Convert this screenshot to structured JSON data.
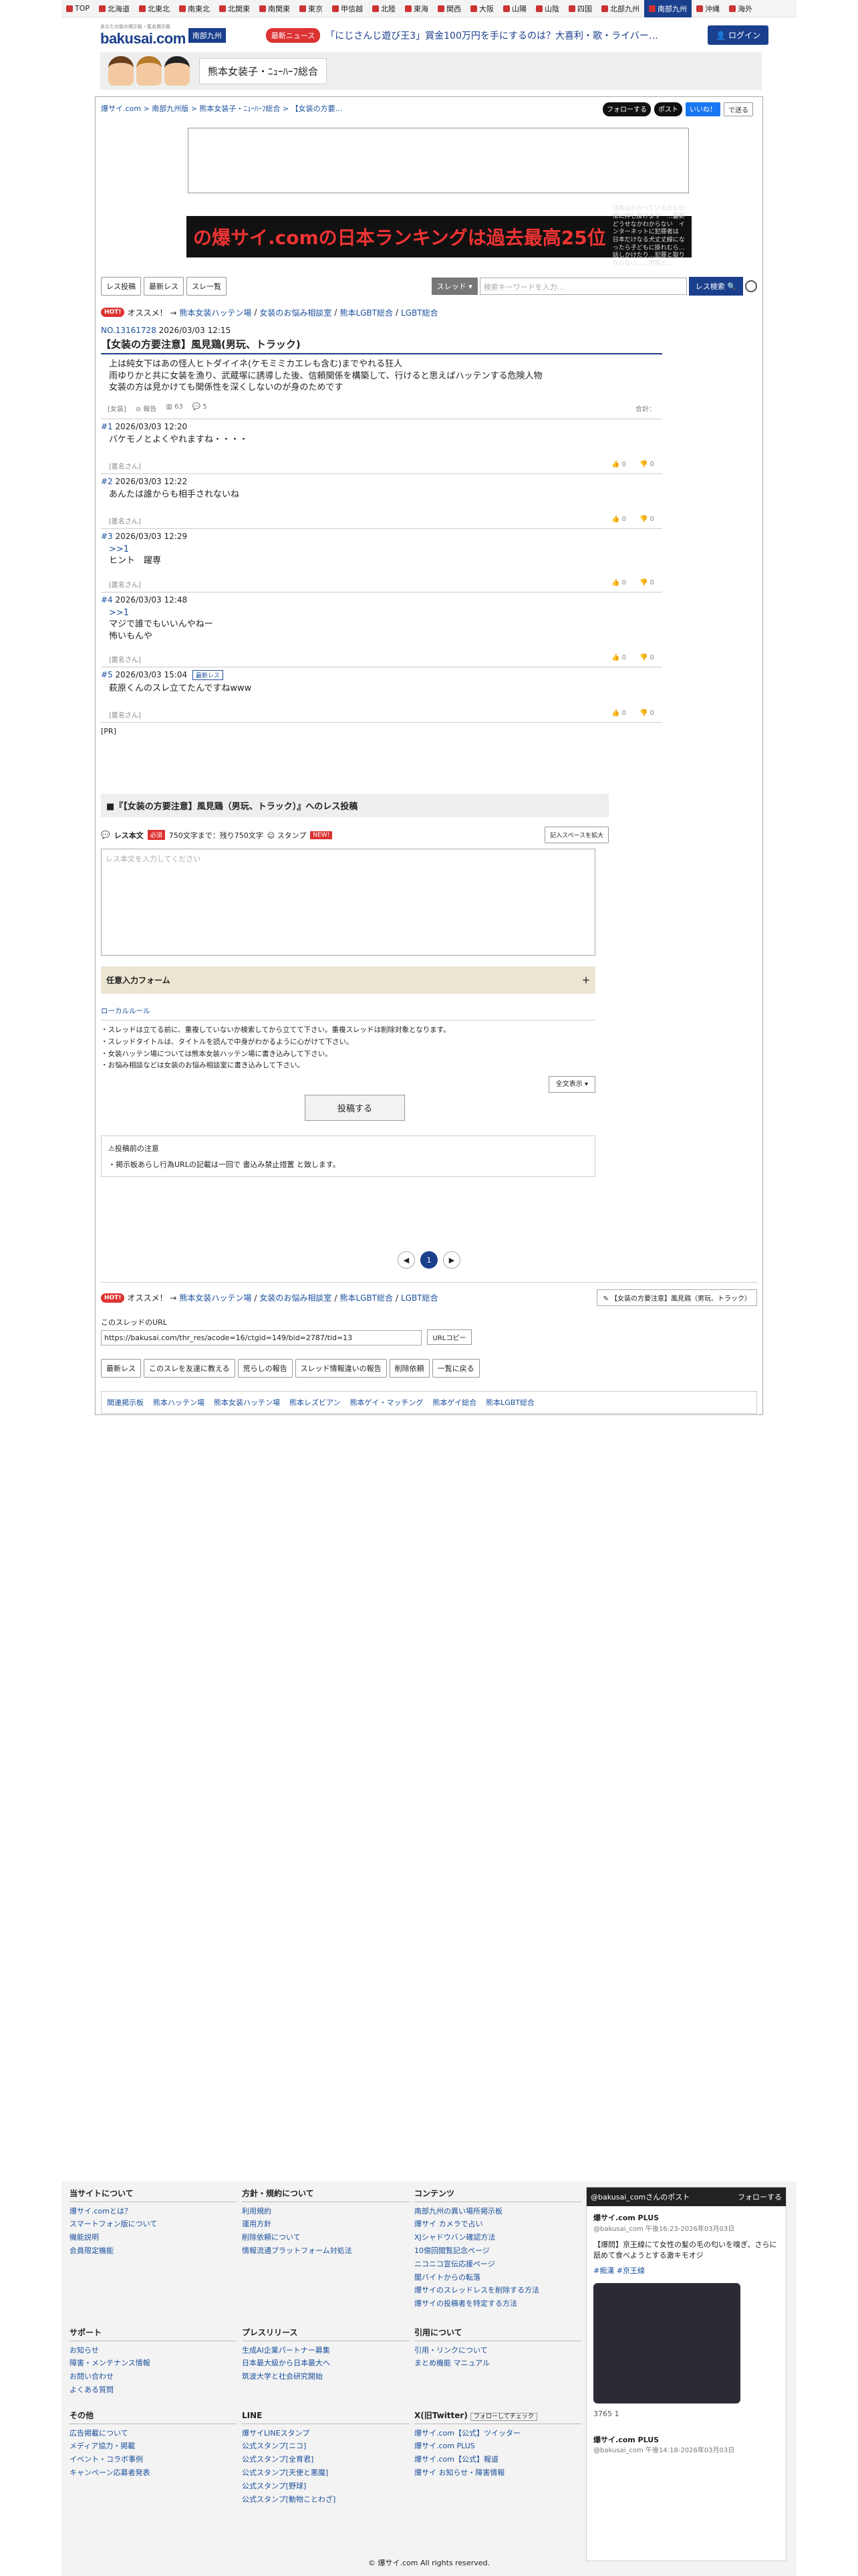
{
  "nav": {
    "regions": [
      "TOP",
      "北海道",
      "北東北",
      "南東北",
      "北関東",
      "南関東",
      "東京",
      "甲信越",
      "北陸",
      "東海",
      "関西",
      "大阪",
      "山陽",
      "山陰",
      "四国",
      "北部九州",
      "南部九州",
      "沖縄",
      "海外"
    ],
    "active": "南部九州"
  },
  "header": {
    "logo": "bakusai.com",
    "logo_sub": "あなたの街の掲示板・匿名掲示板",
    "region": "南部九州",
    "news_badge": "最新ニュース",
    "news_text": "「にじさんじ遊び王3」賞金100万円を手にするのは？大喜利・歌・ライバー…",
    "login": "ログイン"
  },
  "board": {
    "name": "熊本女装子・ﾆｭｰﾊｰﾌ総合"
  },
  "breadcrumb": "爆サイ.com > 南部九州版 > 熊本女装子・ﾆｭｰﾊｰﾌ総合 > 【女装の方要…",
  "share": {
    "follow": "フォローする",
    "post": "ポスト",
    "like": "いいね！",
    "mail": "で送る"
  },
  "rank_banner": {
    "big": "の爆サイ.comの日本ランキングは過去最高25位",
    "small": "住所はわかっているから日常に押し掛けます　…最新　どうせなかわからない　インターネットに犯罪者は　日本だけなる犬丈丈線になったら子どもに掛れむら…　話しかけたり…犯罪と取りならない……学校と…"
  },
  "toolbar": {
    "b1": "レス投稿",
    "b2": "最新レス",
    "b3": "スレ一覧",
    "select": "スレッド ▾",
    "placeholder": "検索キーワードを入力...",
    "search": "レス検索"
  },
  "rec": {
    "hot": "HOT!",
    "label": "オススメ！ →",
    "links": [
      "熊本女装ハッテン場",
      "女装のお悩み相談室",
      "熊本LGBT総合",
      "LGBT総合"
    ]
  },
  "thread": {
    "no": "NO.13161728",
    "date": "2026/03/03 12:15",
    "title": "【女装の方要注意】風見鶏(男玩、トラック)",
    "body": [
      "上は純女下はあの怪人ヒトダイイネ(ケモミミカエレも含む)までやれる狂人",
      "雨ゆりかと共に女装を漁り、武蔵塚に誘導した後、信頼関係を構築して、行けると思えばハッテンする危険人物",
      "女装の方は見かけても関係性を深くしないのが身のためです"
    ],
    "category": "[女装]",
    "report": "報告",
    "views": "63",
    "replies": "5",
    "total": "合計："
  },
  "posts": [
    {
      "num": "#1",
      "date": "2026/03/03 12:20",
      "body": [
        "バケモノとよくやれますね・・・・"
      ],
      "author": "[匿名さん]",
      "up": "0",
      "down": "0",
      "new": ""
    },
    {
      "num": "#2",
      "date": "2026/03/03 12:22",
      "body": [
        "あんたは誰からも相手されないね"
      ],
      "author": "[匿名さん]",
      "up": "0",
      "down": "0",
      "new": ""
    },
    {
      "num": "#3",
      "date": "2026/03/03 12:29",
      "body": [
        ">>1",
        "ヒント　躍専"
      ],
      "author": "[匿名さん]",
      "up": "0",
      "down": "0",
      "new": ""
    },
    {
      "num": "#4",
      "date": "2026/03/03 12:48",
      "body": [
        ">>1",
        "マジで誰でもいいんやねー",
        "怖いもんや"
      ],
      "author": "[匿名さん]",
      "up": "0",
      "down": "0",
      "new": ""
    },
    {
      "num": "#5",
      "date": "2026/03/03 15:04",
      "body": [
        "萩原くんのスレ立てたんですねwww"
      ],
      "author": "[匿名さん]",
      "up": "0",
      "down": "0",
      "new": "最新レス"
    }
  ],
  "pr": "[PR]",
  "form": {
    "head": "■『【女装の方要注意】風見鶏（男玩、トラック）』へのレス投稿",
    "label": "レス本文",
    "required": "必須",
    "limit": "750文字まで：残り750文字",
    "stamp": "スタンプ",
    "new": "NEW!",
    "expand": "記入スペースを拡大",
    "placeholder": "レス本文を入力してください",
    "optional": "任意入力フォーム",
    "plus": "＋",
    "rules_title": "ローカルルール",
    "rules": [
      "・スレッドは立てる前に、重複していないか検索してから立てて下さい。重複スレッドは削除対象となります。",
      "・スレッドタイトルは、タイトルを読んで中身がわかるように心がけて下さい。",
      "・女装ハッテン場については熊本女装ハッテン場に書き込みして下さい。",
      "・お悩み相談などは女装のお悩み相談室に書き込みして下さい。"
    ],
    "show_all": "全文表示 ▾",
    "submit": "投稿する",
    "notice_title": "⚠投稿前の注意",
    "notice": "・掲示板あらし行為URLの記載は一回で 書込み禁止措置 と致します。"
  },
  "pager": {
    "prev": "◀",
    "page": "1",
    "next": "▶"
  },
  "bottom": {
    "tweet": "【女装の方要注意】風見鶏（男玩、トラック）",
    "url_label": "このスレッドのURL",
    "url": "https://bakusai.com/thr_res/acode=16/ctgid=149/bid=2787/tid=13",
    "copy": "URLコピー",
    "actions": [
      "最新レス",
      "このスレを友達に教える",
      "荒らしの報告",
      "スレッド情報違いの報告",
      "削除依頼",
      "一覧に戻る"
    ],
    "related": "関連掲示板",
    "related_links": [
      "熊本ハッテン場",
      "熊本女装ハッテン場",
      "熊本レズビアン",
      "熊本ゲイ・マッチング",
      "熊本ゲイ総合",
      "熊本LGBT総合"
    ]
  },
  "footer": {
    "about": {
      "title": "当サイトについて",
      "items": [
        "爆サイ.comとは？",
        "スマートフォン版について",
        "機能説明",
        "会員限定機能"
      ]
    },
    "terms": {
      "title": "方針・規約について",
      "items": [
        "利用規約",
        "運用方針",
        "削除依頼について",
        "情報流通プラットフォーム対処法"
      ]
    },
    "contents": {
      "title": "コンテンツ",
      "items": [
        "南部九州の異い場所掲示板",
        "爆サイ カメラで占い",
        "XJシャドウバン確認方法",
        "10億回閲覧記念ページ",
        "ニコニコ宣伝応援ページ",
        "闇バイトからの転落",
        "爆サイのスレッドレスを削除する方法",
        "爆サイの投稿者を特定する方法"
      ]
    },
    "support": {
      "title": "サポート",
      "items": [
        "お知らせ",
        "障害・メンテナンス情報",
        "お問い合わせ",
        "よくある質問"
      ]
    },
    "press": {
      "title": "プレスリリース",
      "items": [
        "生成AI企業パートナー募集",
        "日本最大級から日本最大へ",
        "筑波大学と社会研究開始"
      ]
    },
    "quote": {
      "title": "引用について",
      "items": [
        "引用・リンクについて",
        "まとめ機能 マニュアル"
      ]
    },
    "other": {
      "title": "その他",
      "items": [
        "広告掲載について",
        "メディア協力・掲載",
        "イベント・コラボ事例",
        "キャンペーン応募者発表"
      ]
    },
    "line": {
      "title": "LINE",
      "items": [
        "爆サイLINEスタンプ",
        "公式スタンプ[ニコ]",
        "公式スタンプ[全育君]",
        "公式スタンプ[天使と悪魔]",
        "公式スタンプ[野球]",
        "公式スタンプ[動物ことわざ]"
      ]
    },
    "x": {
      "title": "X(旧Twitter)",
      "follow": "フォローしてチェック",
      "items": [
        "爆サイ.com【公式】ツイッター",
        "爆サイ.com PLUS",
        "爆サイ.com【公式】報道",
        "爆サイ お知らせ・障害情報"
      ]
    },
    "timeline": {
      "head": "@bakusai_comさんのポスト",
      "follow": "フォローする",
      "name": "爆サイ.com PLUS",
      "handle": "@bakusai_com 午後16:23-2026年03月03日",
      "text": "【爆問】京王線にて女性の髪の毛の匂いを嗅ぎ、さらに舐めて食べようとする激キモオジ",
      "tags": "#痴漢 #京王線",
      "stats": "3765   1",
      "name2": "爆サイ.com PLUS",
      "handle2": "@bakusai_com 午後14:18-2026年03月03日"
    },
    "copyright": "© 爆サイ.com All rights reserved."
  }
}
